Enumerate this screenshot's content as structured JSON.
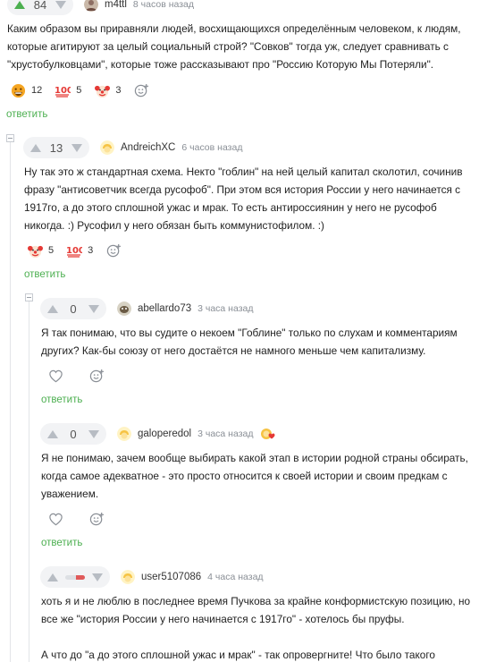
{
  "comments": [
    {
      "id": "c1",
      "rating": "84",
      "user": "m4ttl",
      "time": "8 часов назад",
      "text": "Каким образом вы приравняли людей, восхищающихся определённым человеком, к людям, которые агитируют за целый социальный строй? \"Совков\" тогда уж, следует сравнивать с \"хрустобулковцами\", которые тоже рассказывают про \"Россию Которую Мы Потеряли\".",
      "reactions": [
        {
          "icon": "grin-face-icon",
          "count": "12"
        },
        {
          "icon": "hundred-points-icon",
          "count": "5"
        },
        {
          "icon": "clown-face-icon",
          "count": "3"
        }
      ],
      "reply_label": "ответить"
    },
    {
      "id": "c2",
      "rating": "13",
      "user": "AndreichXC",
      "time": "6 часов назад",
      "text": "Ну так это ж стандартная схема. Некто \"гоблин\" на ней целый капитал сколотил, сочинив фразу \"антисоветчик всегда русофоб\". При этом вся история России у него начинается с 1917го, а до этого сплошной ужас и мрак. То есть антироссиянин у него не русофоб никогда. :) Русофил у него обязан быть коммунистофилом. :)",
      "reactions": [
        {
          "icon": "clown-face-icon",
          "count": "5"
        },
        {
          "icon": "hundred-points-icon",
          "count": "3"
        }
      ],
      "reply_label": "ответить"
    },
    {
      "id": "c3",
      "rating": "0",
      "user": "abellardo73",
      "time": "3 часа назад",
      "text": "Я так понимаю, что вы судите о некоем \"Гоблине\" только по слухам и комментариям других? Как-бы союзу от него достаётся не намного меньше чем капитализму.",
      "reply_label": "ответить"
    },
    {
      "id": "c4",
      "rating": "0",
      "user": "galoperedol",
      "time": "3 часа назад",
      "text": "Я не понимаю, зачем вообще выбирать какой этап в истории родной страны обсирать, когда самое адекватное - это просто относится к своей истории и своим предкам с уважением.",
      "reply_label": "ответить"
    },
    {
      "id": "c5",
      "rating_fraction_negative": 0.45,
      "user": "user5107086",
      "time": "4 часа назад",
      "text": "хоть я и не люблю в последнее время Пучкова за крайне конформистскую позицию, но все же \"история России у него начинается с 1917го\" - хотелось бы пруфы.\n\nА что до \"а до этого сплошной ужас и мрак\" - так опровергните! Что было такого хорошего"
    }
  ],
  "colors": {
    "accent": "#4caf50",
    "vote_bg": "#f2f3f5",
    "negative": "#e05a5a"
  }
}
